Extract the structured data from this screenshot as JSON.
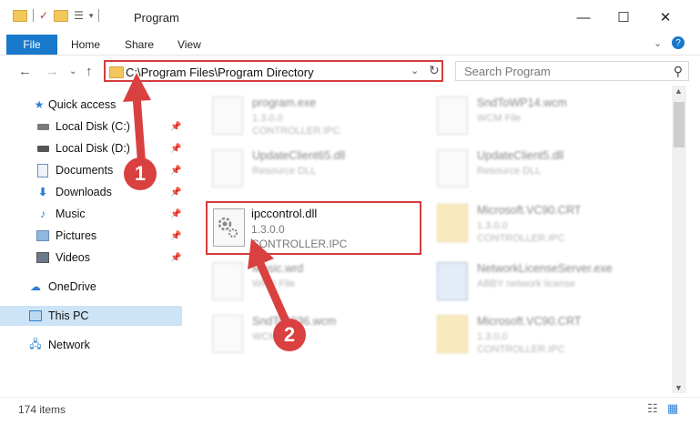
{
  "window": {
    "title": "Program"
  },
  "ribbon": {
    "file": "File",
    "home": "Home",
    "share": "Share",
    "view": "View"
  },
  "address": {
    "path": "C:\\Program Files\\Program Directory"
  },
  "search": {
    "placeholder": "Search Program"
  },
  "sidebar": {
    "items": [
      {
        "label": "Quick access",
        "icon": "star-icon"
      },
      {
        "label": "Local Disk (C:)",
        "icon": "drive-icon"
      },
      {
        "label": "Local Disk (D:)",
        "icon": "drive-icon"
      },
      {
        "label": "Documents",
        "icon": "documents-icon"
      },
      {
        "label": "Downloads",
        "icon": "download-icon"
      },
      {
        "label": "Music",
        "icon": "music-icon"
      },
      {
        "label": "Pictures",
        "icon": "pictures-icon"
      },
      {
        "label": "Videos",
        "icon": "videos-icon"
      },
      {
        "label": "OneDrive",
        "icon": "cloud-icon"
      },
      {
        "label": "This PC",
        "icon": "computer-icon"
      },
      {
        "label": "Network",
        "icon": "network-icon"
      }
    ]
  },
  "files": [
    {
      "name": "program.exe",
      "line2": "1.3.0.0",
      "line3": "CONTROLLER.IPC"
    },
    {
      "name": "SndToWP14.wcm",
      "line2": "WCM File"
    },
    {
      "name": "UpdateClient65.dll",
      "line2": "Resource DLL"
    },
    {
      "name": "UpdateClient5.dll",
      "line2": "Resource DLL"
    },
    {
      "name": "Microsoft.VC90.CRT",
      "line2": "1.3.0.0",
      "line3": "CONTROLLER.IPC"
    },
    {
      "name": "Music.wrd",
      "line2": "WRD File"
    },
    {
      "name": "NetworkLicenseServer.exe",
      "line2": "ABBY network license"
    },
    {
      "name": "SndTo2036.wcm",
      "line2": "WCM File"
    },
    {
      "name": "Microsoft.VC90.CRT",
      "line2": "1.3.0.0",
      "line3": "CONTROLLER.IPC"
    }
  ],
  "highlight": {
    "name": "ipccontrol.dll",
    "version": "1.3.0.0",
    "company": "CONTROLLER.IPC"
  },
  "status": {
    "items": "174 items"
  },
  "markers": {
    "one": "1",
    "two": "2"
  },
  "colors": {
    "accent": "#1979ca",
    "annotation": "#d94040"
  }
}
